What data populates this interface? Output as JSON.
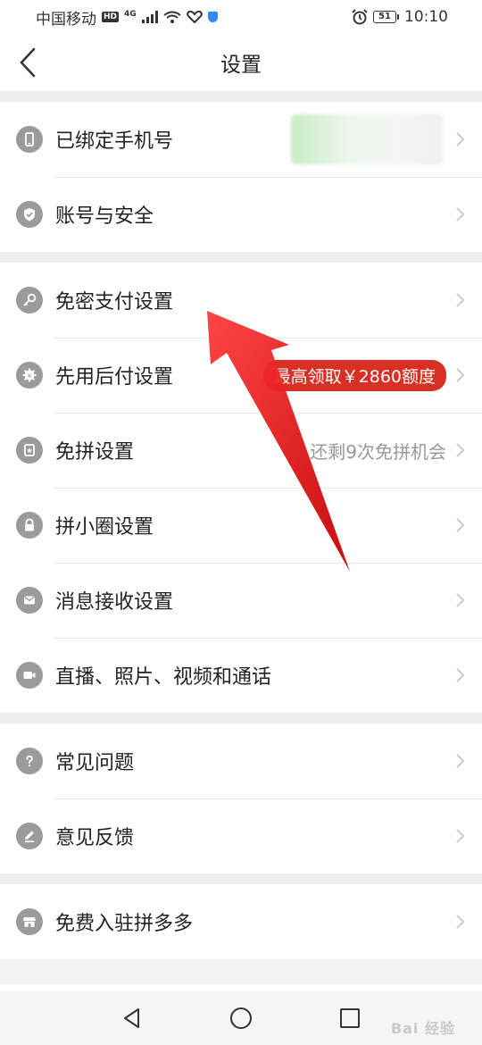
{
  "status_bar": {
    "carrier": "中国移动",
    "hd": "HD",
    "network": "4G",
    "battery": "51",
    "time": "10:10"
  },
  "header": {
    "title": "设置",
    "back_icon": "chevron-left-icon"
  },
  "groups": [
    {
      "items": [
        {
          "label": "已绑定手机号",
          "icon": "phone-icon",
          "value_type": "blurred"
        },
        {
          "label": "账号与安全",
          "icon": "shield-check-icon"
        }
      ]
    },
    {
      "items": [
        {
          "label": "免密支付设置",
          "icon": "key-icon"
        },
        {
          "label": "先用后付设置",
          "icon": "gear-badge-icon",
          "badge": "最高领取￥2860额度",
          "badge_color": "#d93025"
        },
        {
          "label": "免拼设置",
          "icon": "ticket-star-icon",
          "value": "还剩9次免拼机会"
        },
        {
          "label": "拼小圈设置",
          "icon": "lock-icon"
        },
        {
          "label": "消息接收设置",
          "icon": "envelope-icon"
        },
        {
          "label": "直播、照片、视频和通话",
          "icon": "camera-icon"
        }
      ]
    },
    {
      "items": [
        {
          "label": "常见问题",
          "icon": "question-icon"
        },
        {
          "label": "意见反馈",
          "icon": "pencil-icon"
        }
      ]
    },
    {
      "items": [
        {
          "label": "免费入驻拼多多",
          "icon": "store-icon"
        }
      ]
    }
  ],
  "system_nav": {
    "back": "triangle-back-icon",
    "home": "circle-home-icon",
    "recents": "square-recents-icon"
  },
  "watermark": "Bai 经验",
  "colors": {
    "accent_red": "#d93025",
    "icon_gray": "#9b9b9b",
    "separator": "#ededed"
  }
}
